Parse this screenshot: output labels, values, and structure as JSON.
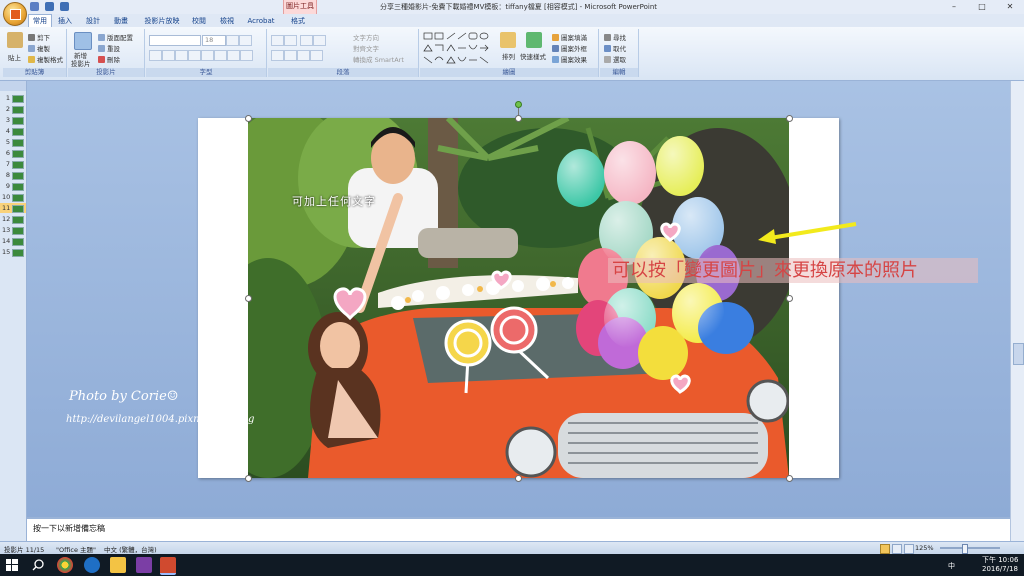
{
  "window": {
    "title": "分享三種婚影片-免費下載婚禮MV模板：tiffany檔夏 [相容模式] - Microsoft PowerPoint",
    "context_tool": "圖片工具",
    "controls": [
      "–",
      "□",
      "✕"
    ]
  },
  "tabs": [
    "常用",
    "插入",
    "設計",
    "動畫",
    "投影片放映",
    "校閱",
    "檢視",
    "Acrobat",
    "格式"
  ],
  "ribbon": {
    "clipboard": {
      "paste": "貼上",
      "cut": "剪下",
      "copy": "複製",
      "format_painter": "複製格式",
      "label": "剪貼簿"
    },
    "slides": {
      "new_slide": "新增",
      "new_slide2": "投影片",
      "layout": "版面配置",
      "reset": "重設",
      "delete": "刪除",
      "label": "投影片"
    },
    "font": {
      "size": "18",
      "label": "字型"
    },
    "paragraph": {
      "text_direction": "文字方向",
      "align_text": "對齊文字",
      "smartart": "轉換成 SmartArt",
      "label": "段落"
    },
    "drawing": {
      "arrange": "排列",
      "quick_styles": "快速樣式",
      "fill": "圖案填滿",
      "outline": "圖案外框",
      "effects": "圖案效果",
      "label": "繪圖"
    },
    "editing": {
      "find": "尋找",
      "replace": "取代",
      "select": "選取",
      "label": "編輯"
    }
  },
  "slide_numbers": [
    "1",
    "2",
    "3",
    "4",
    "5",
    "6",
    "7",
    "8",
    "9",
    "10",
    "11",
    "12",
    "13",
    "14",
    "15"
  ],
  "selected_slide": "11",
  "slide": {
    "overlay_text": "可加上任何文字",
    "watermark_line1": "Photo by Corie☺",
    "watermark_line2": "http://devilangel1004.pixnet.net/blog",
    "callout": "可以按「變更圖片」來更換原本的照片"
  },
  "notes_placeholder": "按一下以新增備忘稿",
  "status": {
    "slide_info": "投影片 11/15",
    "theme": "\"Office 主題\"",
    "language": "中文 (繁體，台灣)",
    "zoom": "125%"
  },
  "taskbar": {
    "time": "下午 10:06",
    "date": "2016/7/18",
    "ime": "中"
  },
  "colors": {
    "callout_text": "#d64444",
    "arrow": "#f2ea1c",
    "ribbon_accent": "#15428b"
  }
}
